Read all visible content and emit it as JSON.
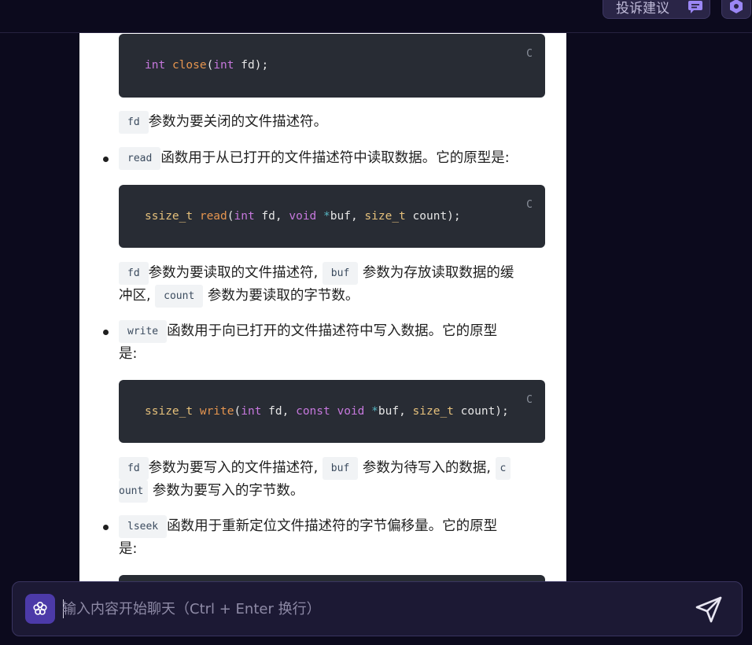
{
  "header": {
    "feedback_label": "投诉建议"
  },
  "content": {
    "close_code": {
      "kw": "int",
      "fn": "close",
      "paren_open": "(",
      "arg_type": "int",
      "arg_rest": " fd);",
      "lang": "C"
    },
    "close_desc": {
      "code": "fd",
      "text": "参数为要关闭的文件描述符。"
    },
    "read_bullet": {
      "code": "read",
      "text": "函数用于从已打开的文件描述符中读取数据。它的原型是:"
    },
    "read_code": {
      "ret": "ssize_t",
      "fn": "read",
      "p1": "(",
      "t1": "int",
      "a1": " fd, ",
      "t2": "void",
      "sp": " ",
      "star": "*",
      "a2": "buf, ",
      "t3": "size_t",
      "a3": " count);",
      "lang": "C"
    },
    "read_desc": {
      "code1": "fd",
      "text1": "参数为要读取的文件描述符,",
      "code2": "buf",
      "text2": "参数为存放读取数据的缓",
      "line2_pre": "冲区,",
      "code3": "count",
      "text3": "参数为要读取的字节数。"
    },
    "write_bullet": {
      "code": "write",
      "text": "函数用于向已打开的文件描述符中写入数据。它的原型",
      "text2": "是:"
    },
    "write_code": {
      "ret": "ssize_t",
      "fn": "write",
      "p1": "(",
      "t1": "int",
      "a1": " fd, ",
      "t2": "const",
      "sp1": " ",
      "t3": "void",
      "sp2": " ",
      "star": "*",
      "a2": "buf, ",
      "t4": "size_t",
      "a3": " count);",
      "lang": "C"
    },
    "write_desc": {
      "code1": "fd",
      "text1": "参数为要写入的文件描述符,",
      "code2": "buf",
      "text2": "参数为待写入的数据,",
      "code3a": "c",
      "code3b": "ount",
      "text3": "参数为要写入的字节数。"
    },
    "lseek_bullet": {
      "code": "lseek",
      "text": "函数用于重新定位文件描述符的字节偏移量。它的原型",
      "text2": "是:"
    }
  },
  "input": {
    "placeholder": "输入内容开始聊天（Ctrl + Enter 换行）"
  },
  "icons": {
    "feedback": "chat-bubble-icon",
    "settings": "hexagon-settings-icon",
    "ai": "sparkle-flower-icon",
    "send": "paper-plane-icon"
  },
  "colors": {
    "background": "#0c0a1d",
    "accent": "#4c3aa8",
    "icon_purple": "#9b87f5",
    "code_bg": "#282c34"
  }
}
